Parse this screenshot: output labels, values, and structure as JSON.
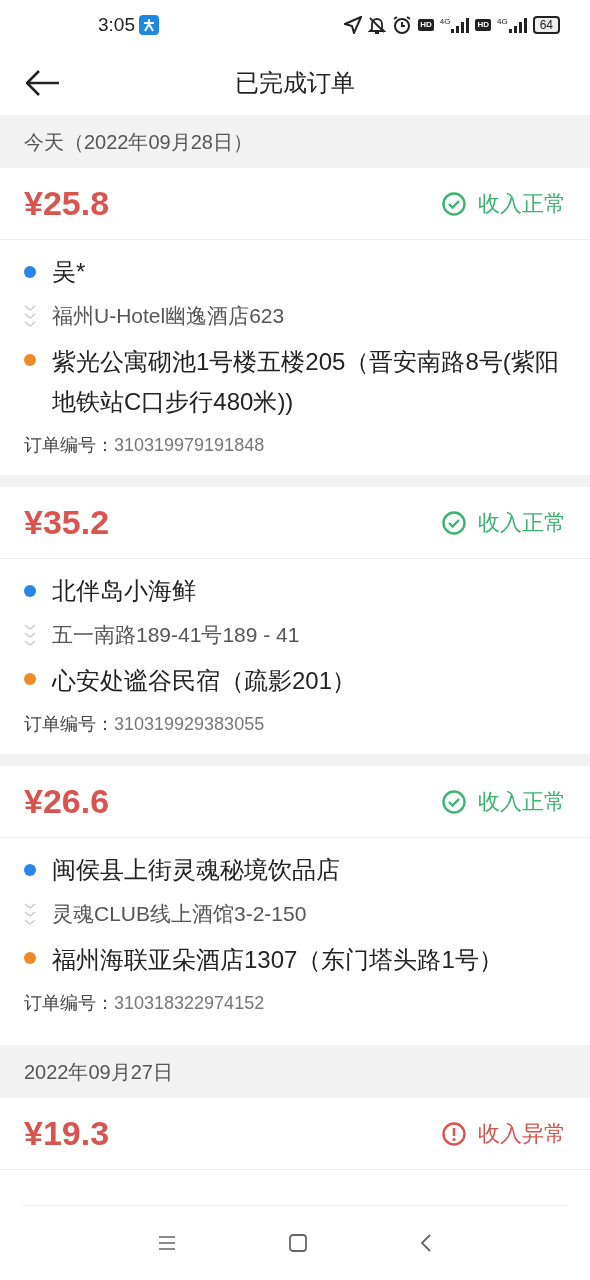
{
  "status_bar": {
    "time": "3:05",
    "sim_labels": [
      {
        "hd": "HD",
        "net": "4G"
      },
      {
        "hd": "HD",
        "net": "4G"
      }
    ],
    "battery": "64"
  },
  "header": {
    "title": "已完成订单"
  },
  "sections": [
    {
      "date": "今天（2022年09月28日）",
      "orders": [
        {
          "amount": "¥25.8",
          "status": {
            "kind": "normal",
            "label": "收入正常"
          },
          "pickup": "吴*",
          "pickup_address": "福州U-Hotel幽逸酒店623",
          "dropoff": "紫光公寓砌池1号楼五楼205（晋安南路8号(紫阳地铁站C口步行480米))",
          "order_no_label": "订单编号：",
          "order_no": "310319979191848"
        },
        {
          "amount": "¥35.2",
          "status": {
            "kind": "normal",
            "label": "收入正常"
          },
          "pickup": "北伴岛小海鲜",
          "pickup_address": "五一南路189-41号189 - 41",
          "dropoff": "心安处谧谷民宿（疏影201）",
          "order_no_label": "订单编号：",
          "order_no": "310319929383055"
        },
        {
          "amount": "¥26.6",
          "status": {
            "kind": "normal",
            "label": "收入正常"
          },
          "pickup": "闽侯县上街灵魂秘境饮品店",
          "pickup_address": "灵魂CLUB线上酒馆3-2-150",
          "dropoff": "福州海联亚朵酒店1307（东门塔头路1号）",
          "order_no_label": "订单编号：",
          "order_no": "310318322974152"
        }
      ]
    },
    {
      "date": "2022年09月27日",
      "orders": [
        {
          "amount": "¥19.3",
          "status": {
            "kind": "abnormal",
            "label": "收入异常"
          }
        }
      ]
    }
  ]
}
